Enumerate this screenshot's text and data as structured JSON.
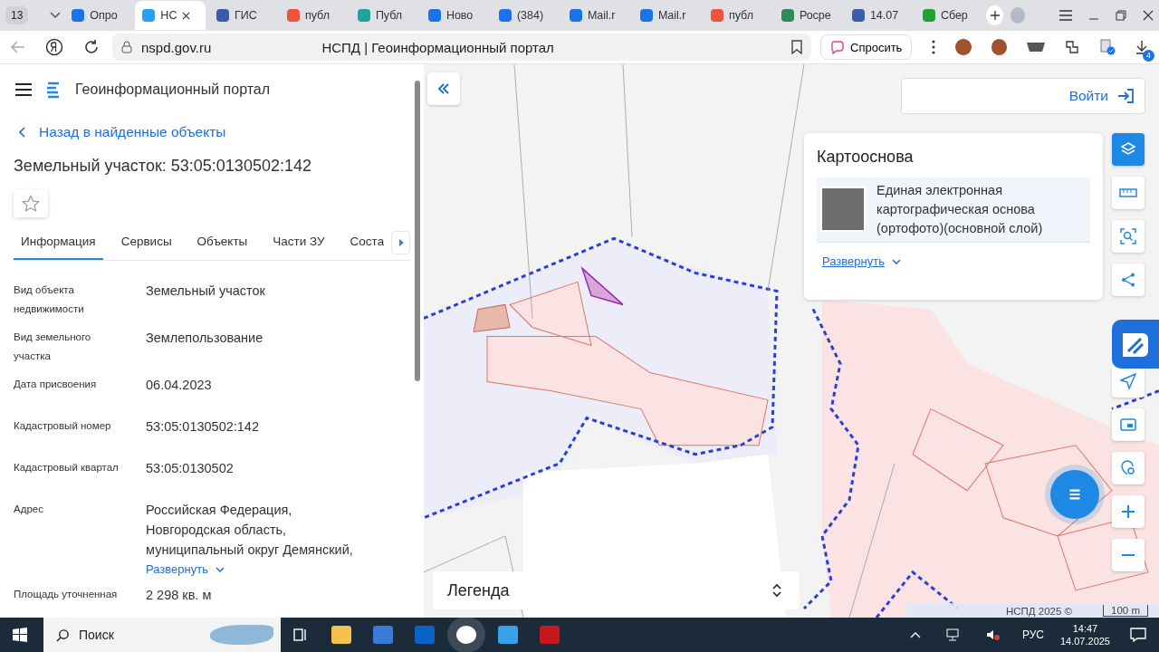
{
  "browser": {
    "tab_count": "13",
    "tabs": [
      {
        "label": "Опро",
        "selected": false,
        "color": "#1a73e8"
      },
      {
        "label": "НС",
        "selected": true,
        "color": "#2a9df4"
      },
      {
        "label": "ГИС",
        "selected": false,
        "color": "#3b5bab"
      },
      {
        "label": "публ",
        "selected": false,
        "color": "#f0523b"
      },
      {
        "label": "Публ",
        "selected": false,
        "color": "#1fa39a"
      },
      {
        "label": "Ново",
        "selected": false,
        "color": "#1a73e8"
      },
      {
        "label": "(384)",
        "selected": false,
        "color": "#1a73e8"
      },
      {
        "label": "Mail.r",
        "selected": false,
        "color": "#1a73e8"
      },
      {
        "label": "Mail.r",
        "selected": false,
        "color": "#1a73e8"
      },
      {
        "label": "публ",
        "selected": false,
        "color": "#f0523b"
      },
      {
        "label": "Росре",
        "selected": false,
        "color": "#2e8b57"
      },
      {
        "label": "14.07",
        "selected": false,
        "color": "#3b5bab"
      },
      {
        "label": "Сбер",
        "selected": false,
        "color": "#21a038"
      }
    ],
    "url": "nspd.gov.ru",
    "page_title": "НСПД | Геоинформационный портал",
    "ask_button": "Спросить",
    "downloads_badge": "4"
  },
  "portal": {
    "title": "Геоинформационный портал",
    "back_link": "Назад в найденные объекты",
    "object_title": "Земельный участок: 53:05:0130502:142",
    "favorite": false,
    "tabs": [
      {
        "label": "Информация",
        "selected": true
      },
      {
        "label": "Сервисы",
        "selected": false
      },
      {
        "label": "Объекты",
        "selected": false
      },
      {
        "label": "Части ЗУ",
        "selected": false
      },
      {
        "label": "Соста",
        "selected": false
      }
    ],
    "fields": [
      {
        "label": "Вид объекта недвижимости",
        "value": "Земельный участок"
      },
      {
        "label": "Вид земельного участка",
        "value": "Землепользование"
      },
      {
        "label": "Дата присвоения",
        "value": "06.04.2023"
      },
      {
        "label": "Кадастровый номер",
        "value": "53:05:0130502:142"
      },
      {
        "label": "Кадастровый квартал",
        "value": "53:05:0130502"
      },
      {
        "label": "Адрес",
        "value": "Российская Федерация, Новгородская область, муниципальный округ Демянский,",
        "expand": "Развернуть"
      },
      {
        "label": "Площадь уточненная",
        "value": "2 298 кв. м"
      }
    ]
  },
  "map": {
    "login": "Войти",
    "basemap": {
      "title": "Картооснова",
      "layer": "Единая электронная картографическая основа (ортофото)(основной слой)",
      "expand": "Развернуть"
    },
    "legend": "Легенда",
    "attribution": "НСПД 2025 ©",
    "scale": "100 m"
  },
  "taskbar": {
    "search": "Поиск",
    "language": "РУС",
    "time": "14:47",
    "date": "14.07.2025"
  }
}
